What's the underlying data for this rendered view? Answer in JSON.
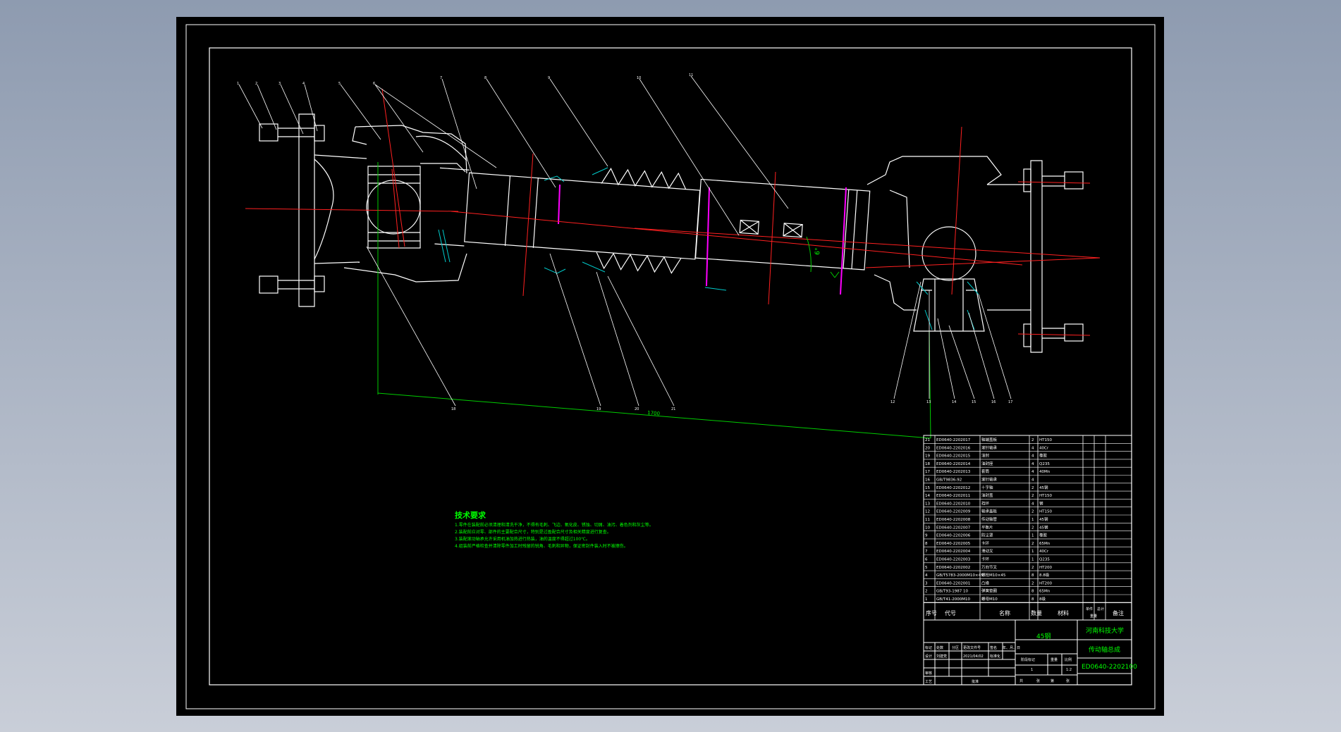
{
  "colors": {
    "background": "#000000",
    "outline": "#ffffff",
    "centerline": "#ff2020",
    "dimension": "#00cc00",
    "leader": "#ffffff",
    "hatch": "#00cccc",
    "accent": "#ff00ff",
    "notes": "#00ff00",
    "table_text": "#ffffff",
    "title_text": "#00ff00"
  },
  "balloons": [
    "1",
    "2",
    "3",
    "4",
    "5",
    "6",
    "7",
    "8",
    "9",
    "10",
    "11",
    "12",
    "13",
    "14",
    "15",
    "16",
    "17",
    "18",
    "19",
    "20",
    "21"
  ],
  "dimension": {
    "length": "1700",
    "angle": "6°"
  },
  "notes": {
    "title": "技术要求",
    "lines": [
      "1.零件在装配前必须清理和清洗干净，不得有毛刺、飞边、氧化皮、锈蚀、切屑、油污、着色剂和灰尘等。",
      "2.装配前应对零、部件的主要配合尺寸，特别是过盈配合尺寸及相关精度进行复查。",
      "3.装配滚动轴承允许采用机油加热进行热装，油的温度不得超过100℃。",
      "4.组装前严格检查并清除零件加工时残留的锐角、毛刺和异物，保证密封件装入时不被擦伤。"
    ]
  },
  "bom": {
    "headers": [
      "序号",
      "代号",
      "名称",
      "数量",
      "材料",
      "单件",
      "总计",
      "重量",
      "备注"
    ],
    "rows": [
      [
        "21",
        "ED0640-2202017",
        "轴端盖板",
        "2",
        "HT150"
      ],
      [
        "20",
        "ED0640-2202016",
        "滚针轴承",
        "4",
        "40Cr"
      ],
      [
        "19",
        "ED0640-2202015",
        "油封",
        "4",
        "橡胶"
      ],
      [
        "18",
        "ED0640-2202014",
        "油封座",
        "4",
        "Q235"
      ],
      [
        "17",
        "ED0640-2202013",
        "套筒",
        "4",
        "40Mn"
      ],
      [
        "16",
        "GB/T9836-92",
        "滚针轴承",
        "4",
        ""
      ],
      [
        "15",
        "ED0640-2202012",
        "十字轴",
        "2",
        "45钢"
      ],
      [
        "14",
        "ED0640-2202011",
        "油封盖",
        "2",
        "HT150"
      ],
      [
        "13",
        "ED0640-2202010",
        "挡环",
        "4",
        "钢"
      ],
      [
        "12",
        "ED0640-2202009",
        "轴承盖板",
        "2",
        "HT150"
      ],
      [
        "11",
        "ED0640-2202008",
        "传动轴管",
        "1",
        "45钢"
      ],
      [
        "10",
        "ED0640-2202007",
        "平衡片",
        "2",
        "45钢"
      ],
      [
        "9",
        "ED0640-2202006",
        "防尘罩",
        "1",
        "橡胶"
      ],
      [
        "8",
        "ED0640-2202005",
        "卡环",
        "2",
        "65Mn"
      ],
      [
        "7",
        "ED0640-2202004",
        "滑动叉",
        "1",
        "40Cr"
      ],
      [
        "6",
        "ED0640-2202003",
        "卡环",
        "1",
        "Q235"
      ],
      [
        "5",
        "ED0640-2202002",
        "万向节叉",
        "2",
        "HT200"
      ],
      [
        "4",
        "GB/T5783-2000M10×45",
        "螺栓M10×45",
        "8",
        "8.8级"
      ],
      [
        "3",
        "ED0640-2202001",
        "凸缘",
        "2",
        "HT200"
      ],
      [
        "2",
        "GB/T93-1987 10",
        "弹簧垫圈",
        "8",
        "65Mn"
      ],
      [
        "1",
        "GB/T41-2000M10",
        "螺母M10",
        "8",
        "8级"
      ]
    ]
  },
  "title_block": {
    "material": "45钢",
    "school": "河南科技大学",
    "drawing_name": "传动轴总成",
    "drawing_number": "ED0640-2202100",
    "scale": "1:2",
    "qty": "1",
    "labels": {
      "mark": "标记",
      "count": "处数",
      "zone": "分区",
      "change_doc": "更改文件号",
      "sign": "签名",
      "date": "年、月、日",
      "design": "设计",
      "std": "标准化",
      "check": "审核",
      "process": "工艺",
      "approve": "批准",
      "stage": "阶段标记",
      "weight": "重量",
      "ratio": "比例",
      "sheet_total": "共",
      "sheet": "张",
      "sheet_no": "第"
    },
    "signer": "刘建党",
    "date_value": "2021/04/02"
  }
}
